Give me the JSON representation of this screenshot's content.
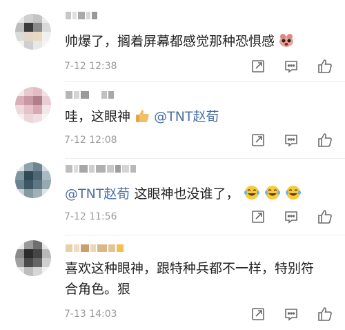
{
  "comments": [
    {
      "text": "帅爆了，搁着屏幕都感觉那种恐惧感",
      "time": "7-12 12:38",
      "emoji": "scared-face-icon"
    },
    {
      "text_before": "哇，这眼神",
      "mention": "@TNT赵荀",
      "time": "7-12 12:08",
      "emoji": "thumbs-up-icon"
    },
    {
      "mention": "@TNT赵荀",
      "text_after": " 这眼神也没谁了，",
      "time": "7-12 11:56",
      "emoji": "laughing-tears-icon"
    },
    {
      "text_line1": "喜欢这种眼神，跟特种兵都不一样，特别符",
      "text_line2": "合角色。狠",
      "time": "7-13 14:03"
    }
  ],
  "colors": {
    "mention": "#4b6fa3",
    "time": "#9a9a9a",
    "icon": "#6b6b6b"
  },
  "icons": [
    "share-icon",
    "comment-icon",
    "like-icon"
  ]
}
